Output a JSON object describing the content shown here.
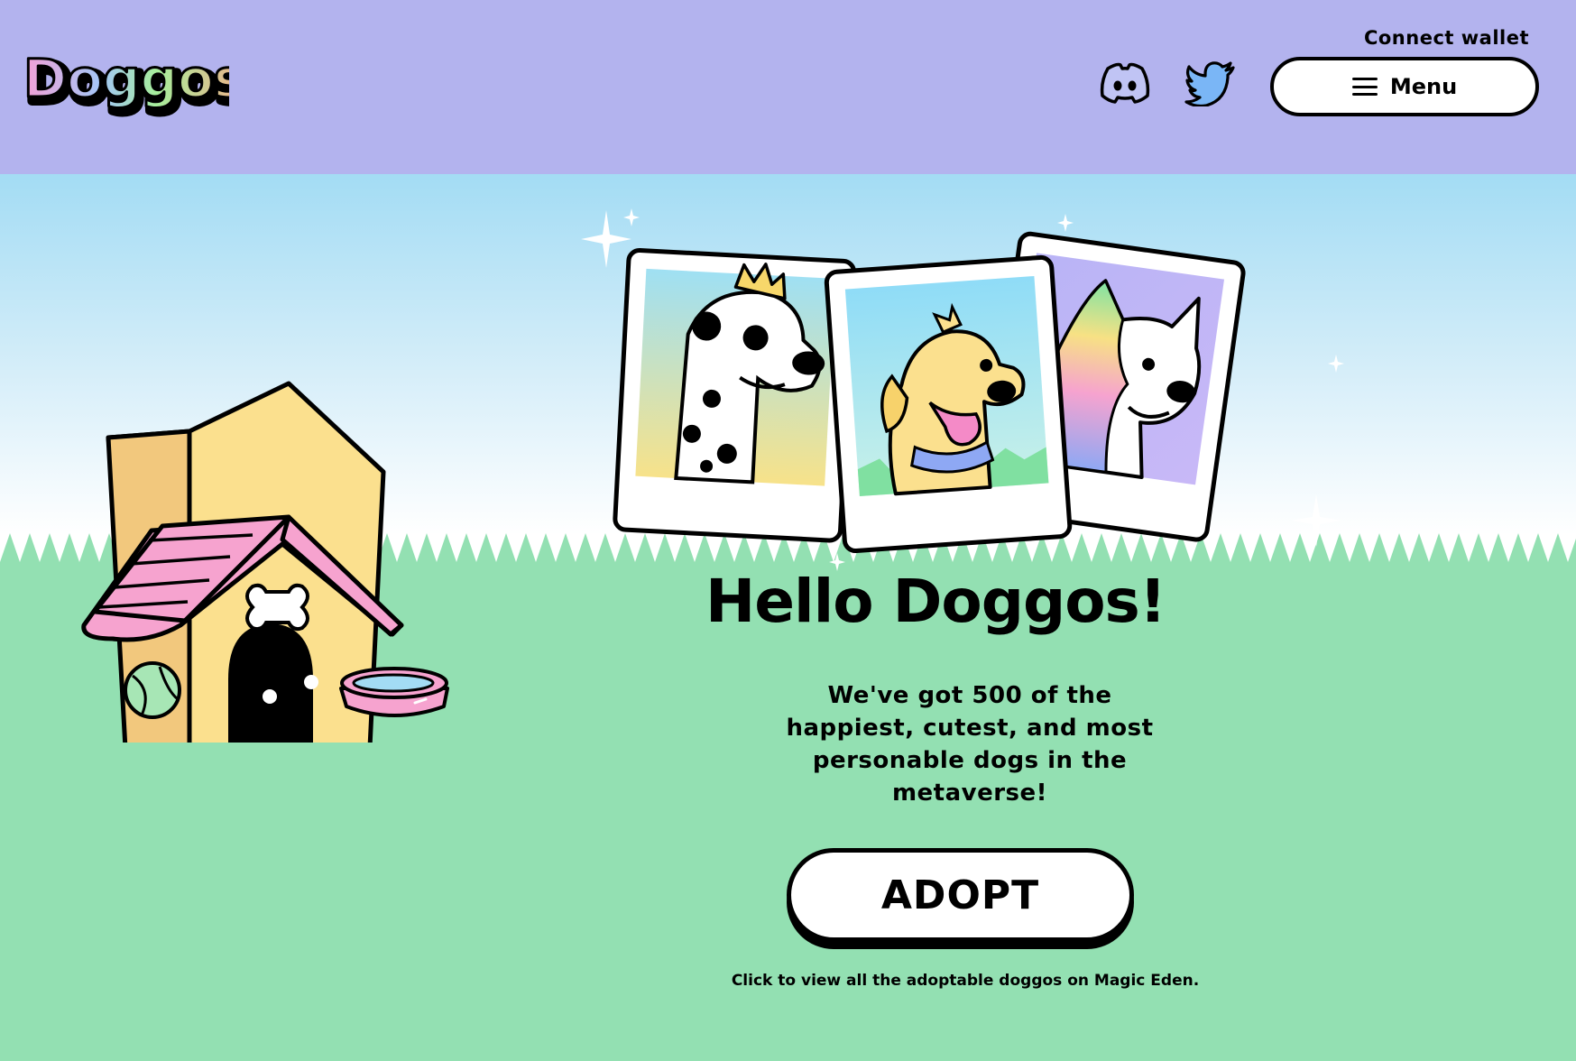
{
  "header": {
    "logo_text": "Doggos",
    "connect_wallet": "Connect wallet",
    "menu_label": "Menu",
    "icons": [
      "discord-icon",
      "twitter-icon",
      "hamburger-icon"
    ]
  },
  "hero": {
    "title": "Hello Doggos!",
    "intro": "We've got 500 of the happiest, cutest, and most personable dogs in the metaverse!",
    "adopt_label": "ADOPT",
    "hint": "Click to view all the adoptable doggos on Magic Eden."
  },
  "polaroids": [
    {
      "dog": "dalmatian-with-crown"
    },
    {
      "dog": "golden-puppy-with-bandana"
    },
    {
      "dog": "rainbow-corgi"
    }
  ],
  "colors": {
    "header_bg": "#b3b3ee",
    "sky_top": "#a3dcf4",
    "grass": "#93e0b2",
    "roof_pink": "#f6a3cf",
    "house_yellow": "#f9de85"
  }
}
